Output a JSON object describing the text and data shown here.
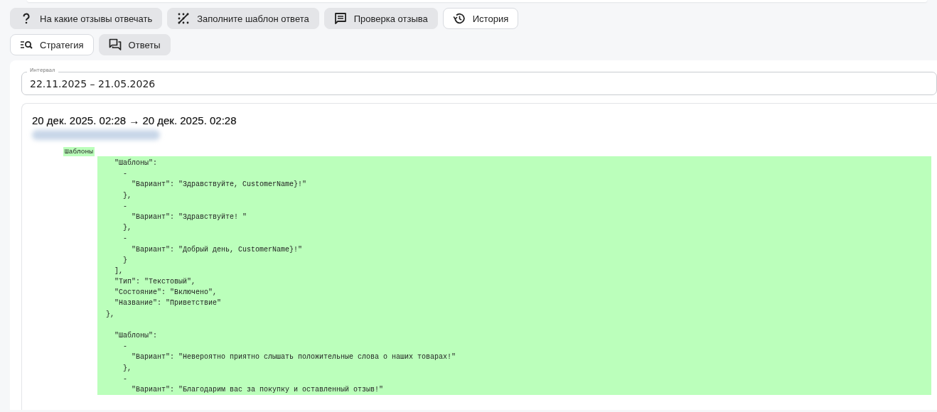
{
  "toolbar": {
    "buttons": [
      {
        "label": "На какие отзывы отвечать",
        "selected": true
      },
      {
        "label": "Заполните шаблон ответа",
        "selected": true
      },
      {
        "label": "Проверка отзыва",
        "selected": true
      },
      {
        "label": "История",
        "selected": false
      },
      {
        "label": "Стратегия",
        "selected": false
      },
      {
        "label": "Ответы",
        "selected": true
      }
    ]
  },
  "interval": {
    "label": "Интервал",
    "value": "22.11.2025 – 21.05.2026"
  },
  "entry": {
    "title": "20 дек. 2025. 02:28 → 20 дек. 2025. 02:28",
    "section": "Шаблоны",
    "blocks": [
      [
        "    \"Шаблоны\":",
        "      -",
        "        \"Вариант\": \"Здравствуйте, CustomerName}!\"",
        "      },",
        "      -",
        "        \"Вариант\": \"Здравствуйте! \"",
        "      },",
        "      -",
        "        \"Вариант\": \"Добрый день, CustomerName}!\"",
        "      }",
        "    ],",
        "    \"Тип\": \"Текстовый\",",
        "    \"Состояние\": \"Включено\",",
        "    \"Название\": \"Приветствие\"",
        "  },"
      ],
      [
        "    \"Шаблоны\":",
        "      -",
        "        \"Вариант\": \"Невероятно приятно слышать положительные слова о наших товарах!\"",
        "      },",
        "      -",
        "        \"Вариант\": \"Благодарим вас за покупку и оставленный отзыв!\""
      ]
    ]
  }
}
